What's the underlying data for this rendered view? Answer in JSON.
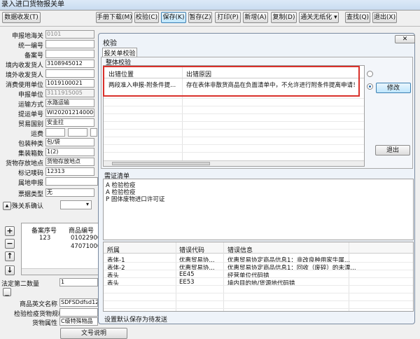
{
  "window": {
    "title": "录入进口货物报关单"
  },
  "toolbar": {
    "data_exchange": "数据收发(T)",
    "buttons": [
      "手册下载(M)",
      "校验(C)",
      "保存(K)",
      "暂存(Z)",
      "打印(P)",
      "新增(A)",
      "复制(D)",
      "通关无纸化 ▾",
      "查找(Q)",
      "退出(X)"
    ]
  },
  "form": {
    "fields": [
      {
        "label": "申报地海关",
        "value": "0101"
      },
      {
        "label": "统一编号",
        "value": ""
      },
      {
        "label": "备案号",
        "value": ""
      },
      {
        "label": "境内收发货人",
        "value": "3108945012"
      },
      {
        "label": "境外收发货人",
        "value": ""
      },
      {
        "label": "消费使用单位",
        "value": "1019100021"
      },
      {
        "label": "申报单位",
        "value": "3111915005"
      },
      {
        "label": "运输方式",
        "value": "水路运输"
      },
      {
        "label": "提运单号",
        "value": "WI2020121400001"
      },
      {
        "label": "贸易国别",
        "value": "安圭拉"
      },
      {
        "label": "运费",
        "value": ""
      },
      {
        "label": "包装种类",
        "value": "包/袋"
      },
      {
        "label": "集装箱数",
        "value": "1(2)"
      },
      {
        "label": "货物存放地点",
        "value": "货物存放地点"
      },
      {
        "label": "标记唛码",
        "value": "12313"
      },
      {
        "label": "属地申报",
        "value": ""
      },
      {
        "label": "票据类型",
        "value": "无"
      },
      {
        "label": "特殊关系确认",
        "value": ""
      }
    ]
  },
  "goods_table": {
    "headers": [
      "备案序号",
      "商品编号"
    ],
    "rows": [
      [
        "123",
        "01022900"
      ],
      [
        "",
        "47071000"
      ]
    ]
  },
  "goods_form": [
    {
      "label": "法定第二数量",
      "value": "1"
    },
    {
      "label": "商品英文名称",
      "value": "SDFSDdfsd12"
    },
    {
      "label": "检验检疫货物规格",
      "value": ""
    },
    {
      "label": "货物属性",
      "value": "C级特殊物品"
    }
  ],
  "goods_button": "文号说明",
  "dialog": {
    "title": "校验",
    "close": "✕",
    "tab": "报关单校验",
    "group": "整体校验",
    "check_headers": [
      "出错位置",
      "出错原因"
    ],
    "check_rows": [
      [
        "两段准入申报-附条件提...",
        "存在表体非散货商品在负面清单中，不允许进行附条件提离申请！"
      ]
    ],
    "modify": "修改",
    "exit": "退出",
    "cert_label": "需证清单",
    "certs": [
      "A 检验检疫",
      "A 检验检疫",
      "P 固体废物进口许可证"
    ],
    "error_headers": [
      "所属",
      "错误代码",
      "错误信息"
    ],
    "error_rows": [
      [
        "表体-1",
        "优惠贸易协...",
        "优惠贸易协定商品信息1：非改良种用家牛属..."
      ],
      [
        "表体-2",
        "优惠贸易协...",
        "优惠贸易协定商品信息1：回收（废碎）的未漂..."
      ],
      [
        "表头",
        "EE45",
        "经营单位代码错"
      ],
      [
        "表头",
        "EE53",
        "境内目的地/货源地代码错"
      ]
    ],
    "status": "设置默认保存为待发送"
  },
  "colors": {
    "highlight_box": "#d9312b",
    "title_bar": "#c9dcf0"
  }
}
